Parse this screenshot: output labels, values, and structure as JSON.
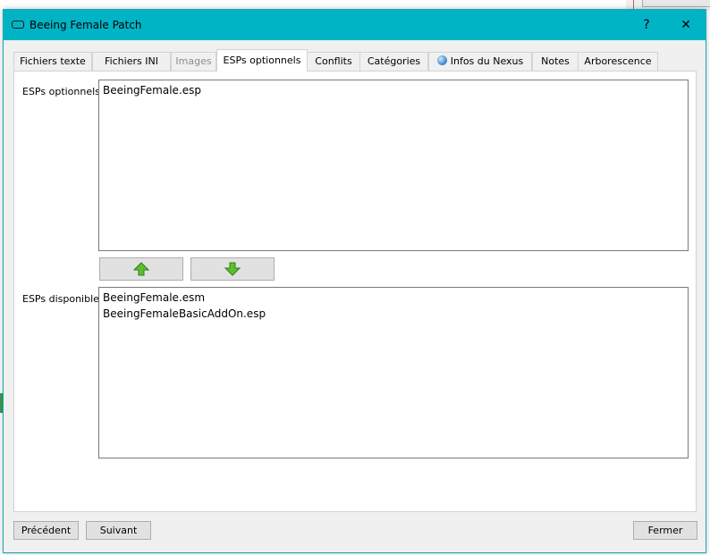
{
  "window": {
    "title": "Beeing Female Patch",
    "help_label": "?",
    "close_label": "✕"
  },
  "tabs": [
    {
      "label": "Fichiers texte",
      "state": "normal"
    },
    {
      "label": "Fichiers INI",
      "state": "normal"
    },
    {
      "label": "Images",
      "state": "disabled"
    },
    {
      "label": "ESPs optionnels",
      "state": "active"
    },
    {
      "label": "Conflits",
      "state": "normal"
    },
    {
      "label": "Catégories",
      "state": "normal"
    },
    {
      "label": "Infos du Nexus",
      "state": "normal",
      "icon": "globe-icon"
    },
    {
      "label": "Notes",
      "state": "normal"
    },
    {
      "label": "Arborescence",
      "state": "normal"
    }
  ],
  "optional": {
    "label": "ESPs optionnels",
    "items": [
      "BeeingFemale.esp"
    ]
  },
  "move_buttons": {
    "up_icon": "green-up-arrow-icon",
    "down_icon": "green-down-arrow-icon"
  },
  "available": {
    "label": "ESPs disponibles",
    "items": [
      "BeeingFemale.esm",
      "BeeingFemaleBasicAddOn.esp"
    ]
  },
  "footer": {
    "prev_label": "Précédent",
    "next_label": "Suivant",
    "close_label": "Fermer"
  },
  "colors": {
    "titlebar": "#00b4c6",
    "arrow_green": "#4caf2a"
  }
}
